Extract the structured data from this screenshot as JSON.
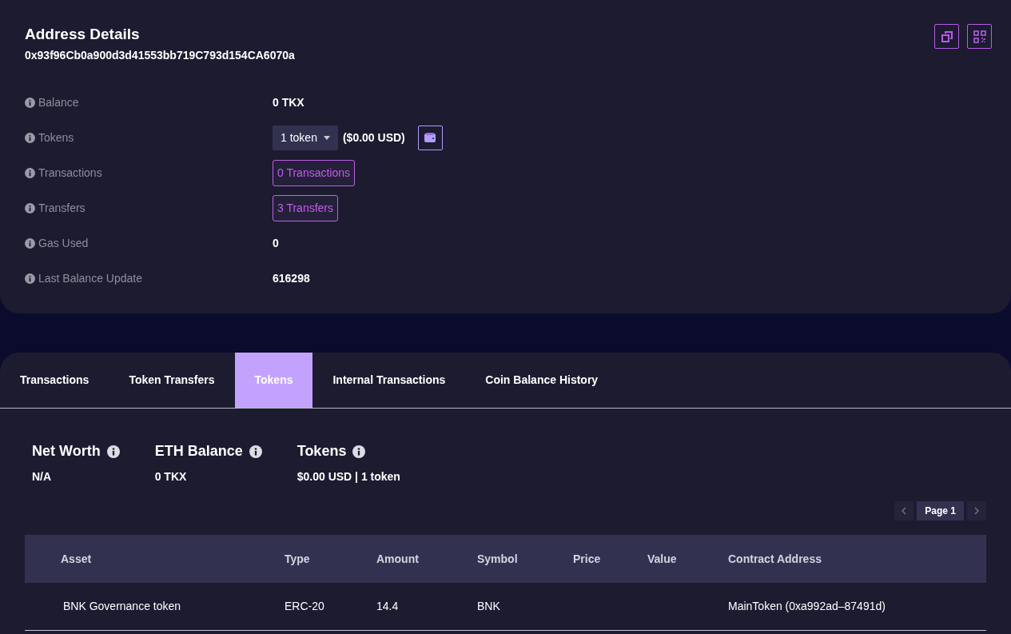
{
  "address": {
    "title": "Address Details",
    "hash": "0x93f96Cb0a900d3d41553bb719C793d154CA6070a"
  },
  "details": [
    {
      "kind": "text",
      "label": "Balance",
      "value": "0 TKX"
    },
    {
      "kind": "dropdown",
      "label": "Tokens",
      "value": "1 token",
      "note": "($0.00 USD)"
    },
    {
      "kind": "link",
      "label": "Transactions",
      "value": "0 Transactions"
    },
    {
      "kind": "link",
      "label": "Transfers",
      "value": "3 Transfers"
    },
    {
      "kind": "text",
      "label": "Gas Used",
      "value": "0"
    },
    {
      "kind": "text",
      "label": "Last Balance Update",
      "value": "616298"
    }
  ],
  "tabs": [
    {
      "label": "Transactions",
      "selected": false
    },
    {
      "label": "Token Transfers",
      "selected": false
    },
    {
      "label": "Tokens",
      "selected": true
    },
    {
      "label": "Internal Transactions",
      "selected": false
    },
    {
      "label": "Coin Balance History",
      "selected": false
    }
  ],
  "summary": [
    {
      "label": "Net Worth",
      "value": "N/A"
    },
    {
      "label": "ETH Balance",
      "value": "0 TKX"
    },
    {
      "label": "Tokens",
      "value": "$0.00 USD | 1 token"
    }
  ],
  "pagination": {
    "page": "Page 1"
  },
  "table": {
    "columns": [
      "Asset",
      "Type",
      "Amount",
      "Symbol",
      "Price",
      "Value",
      "Contract Address"
    ],
    "rows": [
      [
        "BNK Governance token",
        "ERC-20",
        "14.4",
        "BNK",
        "",
        "",
        "MainToken (0xa992ad–87491d)"
      ]
    ]
  }
}
